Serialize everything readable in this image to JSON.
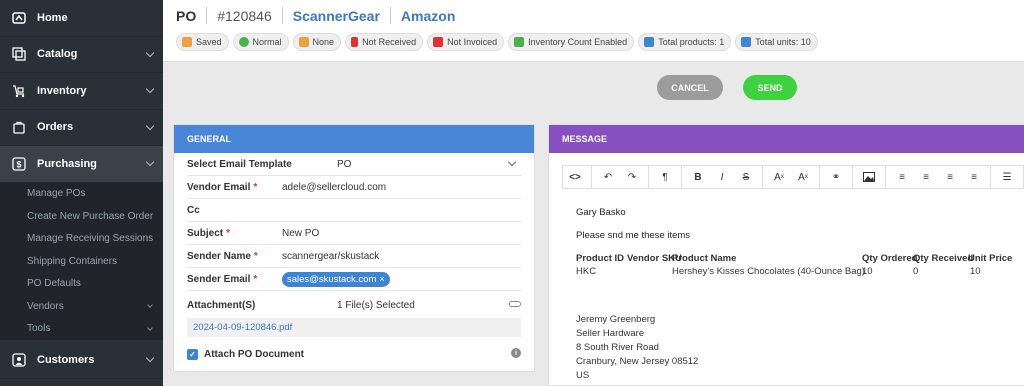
{
  "sidebar": {
    "items": [
      {
        "label": "Home",
        "icon": "home-icon"
      },
      {
        "label": "Catalog",
        "icon": "catalog-icon"
      },
      {
        "label": "Inventory",
        "icon": "inventory-icon"
      },
      {
        "label": "Orders",
        "icon": "orders-icon"
      },
      {
        "label": "Purchasing",
        "icon": "purchasing-icon"
      }
    ],
    "purchasing_sub": [
      {
        "label": "Manage POs"
      },
      {
        "label": "Create New Purchase Order"
      },
      {
        "label": "Manage Receiving Sessions"
      },
      {
        "label": "Shipping Containers"
      },
      {
        "label": "PO Defaults"
      },
      {
        "label": "Vendors"
      },
      {
        "label": "Tools"
      }
    ],
    "customers_label": "Customers"
  },
  "header": {
    "po_label": "PO",
    "po_number": "#120846",
    "vendor": "ScannerGear",
    "channel": "Amazon",
    "badges": [
      {
        "label": "Saved",
        "color": "#f0a040"
      },
      {
        "label": "Normal",
        "color": "#4caf50"
      },
      {
        "label": "None",
        "color": "#f0a040"
      },
      {
        "label": "Not Received",
        "color": "#d33"
      },
      {
        "label": "Not Invoiced",
        "color": "#d33"
      },
      {
        "label": "Inventory Count Enabled",
        "color": "#4caf50"
      },
      {
        "label": "Total products: 1",
        "color": "#3f84d2"
      },
      {
        "label": "Total units: 10",
        "color": "#3f84d2"
      }
    ]
  },
  "actions": {
    "cancel": "CANCEL",
    "send": "SEND"
  },
  "general": {
    "title": "GENERAL",
    "template_label": "Select Email Template",
    "template_value": "PO",
    "vendor_email_label": "Vendor Email",
    "vendor_email": "adele@sellercloud.com",
    "cc_label": "Cc",
    "subject_label": "Subject",
    "subject": "New PO",
    "sender_name_label": "Sender Name",
    "sender_name": "scannergear/skustack",
    "sender_email_label": "Sender Email",
    "sender_email": "sales@skustack.com",
    "attachments_label": "Attachment(S)",
    "files_selected": "1 File(s) Selected",
    "file_name": "2024-04-09-120846.pdf",
    "attach_po_label": "Attach PO Document",
    "required_mark": "*"
  },
  "message": {
    "title": "MESSAGE",
    "greeting": "Gary Basko",
    "line1": "Please snd me these items",
    "table_headers": [
      "Product ID",
      "Vendor SKU",
      "Product Name",
      "Qty Ordered",
      "Qty Received",
      "Unit Price"
    ],
    "table_row": [
      "HKC",
      "",
      "Hershey's Kisses Chocolates (40-Ounce Bag)",
      "10",
      "0",
      "10"
    ],
    "signature": [
      "Jeremy Greenberg",
      "Seller Hardware",
      "8 South River Road",
      "Cranbury, New Jersey 08512",
      "US"
    ]
  },
  "colors": {
    "general_header": "#4a86d8",
    "message_header": "#8750c0",
    "cancel": "#9c9c9c",
    "send": "#3fd13f"
  }
}
